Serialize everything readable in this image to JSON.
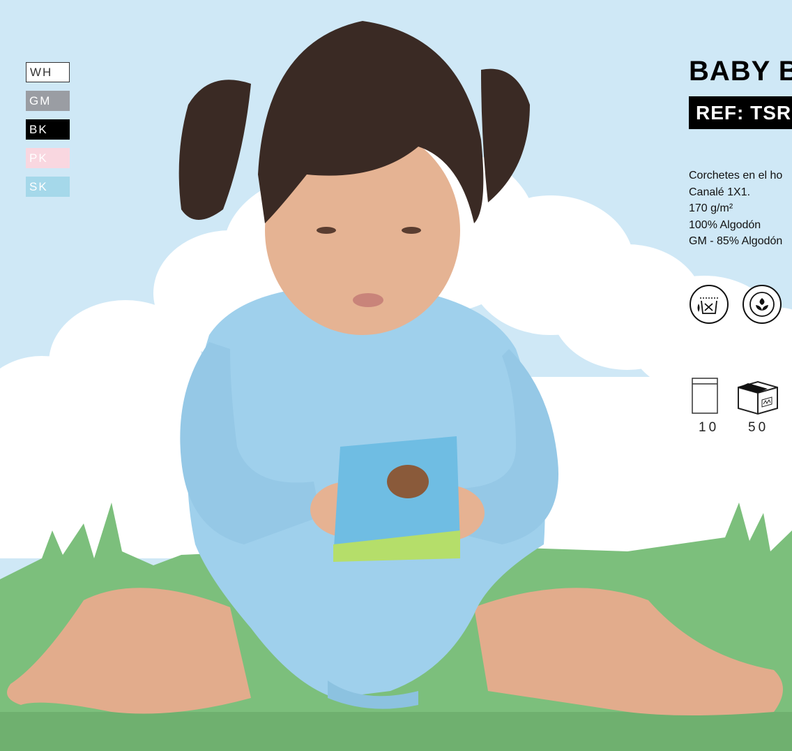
{
  "swatches": [
    {
      "code": "WH",
      "color": "#ffffff"
    },
    {
      "code": "GM",
      "color": "#9a9da3"
    },
    {
      "code": "BK",
      "color": "#000000"
    },
    {
      "code": "PK",
      "color": "#f9d7e0"
    },
    {
      "code": "SK",
      "color": "#a5d8ea"
    }
  ],
  "product": {
    "title": "BABY B",
    "ref": "REF: TSR"
  },
  "specs": [
    "Corchetes en el ho",
    "Canalé 1X1.",
    "170 g/m²",
    "100% Algodón",
    "GM - 85% Algodón"
  ],
  "care_icons": [
    "hand-wash-icon",
    "cotton-icon"
  ],
  "packaging": [
    {
      "icon": "bag-icon",
      "count": "10"
    },
    {
      "icon": "box-icon",
      "count": "50"
    }
  ],
  "colors": {
    "sky": "#cfe8f6",
    "cloud": "#ffffff",
    "grass": "#7cbf7c",
    "bodysuit": "#9fd0ec"
  }
}
